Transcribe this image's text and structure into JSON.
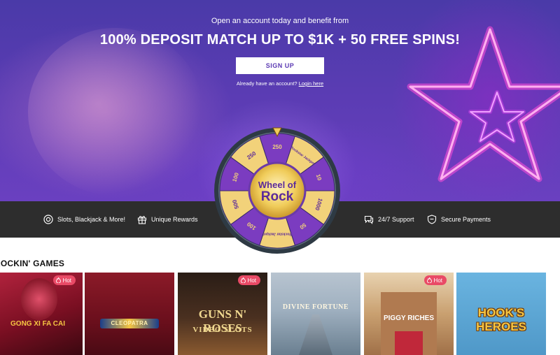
{
  "promo": {
    "subtitle": "Open an account today and benefit from",
    "headline": "100% DEPOSIT MATCH UP TO $1K + 50 FREE SPINS!",
    "signup_label": "SIGN UP",
    "login_prompt": "Already have an account?",
    "login_label": "Login here"
  },
  "wheel": {
    "title_line1": "Wheel of",
    "title_line2": "Rock",
    "segments": [
      "250",
      "Rockstar Jackpot",
      "10",
      "1000",
      "50",
      "Rockstar Jackpot",
      "100",
      "500",
      "100",
      "250"
    ]
  },
  "features": [
    {
      "label": "Slots, Blackjack & More!",
      "icon": "chip-icon"
    },
    {
      "label": "Unique Rewards",
      "icon": "gift-icon"
    },
    {
      "label": "24/7 Support",
      "icon": "chat-icon"
    },
    {
      "label": "Secure Payments",
      "icon": "shield-icon"
    }
  ],
  "games_section": {
    "title": "ROCKIN' GAMES",
    "hot_label": "Hot",
    "games": [
      {
        "title": "GONG XI FA CAI",
        "hot": true,
        "color": "#8b1a2c"
      },
      {
        "title": "CLEOPATRA",
        "hot": false,
        "color": "#7a1420"
      },
      {
        "title": "GUNS N' ROSES",
        "subtitle": "VIDEO SLOTS",
        "hot": true,
        "color": "#3a2a20"
      },
      {
        "title": "DIVINE FORTUNE",
        "hot": false,
        "color": "#8fa0b0"
      },
      {
        "title": "PIGGY RICHES",
        "hot": true,
        "color": "#c9a070"
      },
      {
        "title": "HOOK'S HEROES",
        "hot": false,
        "color": "#5fa7d6"
      }
    ]
  }
}
